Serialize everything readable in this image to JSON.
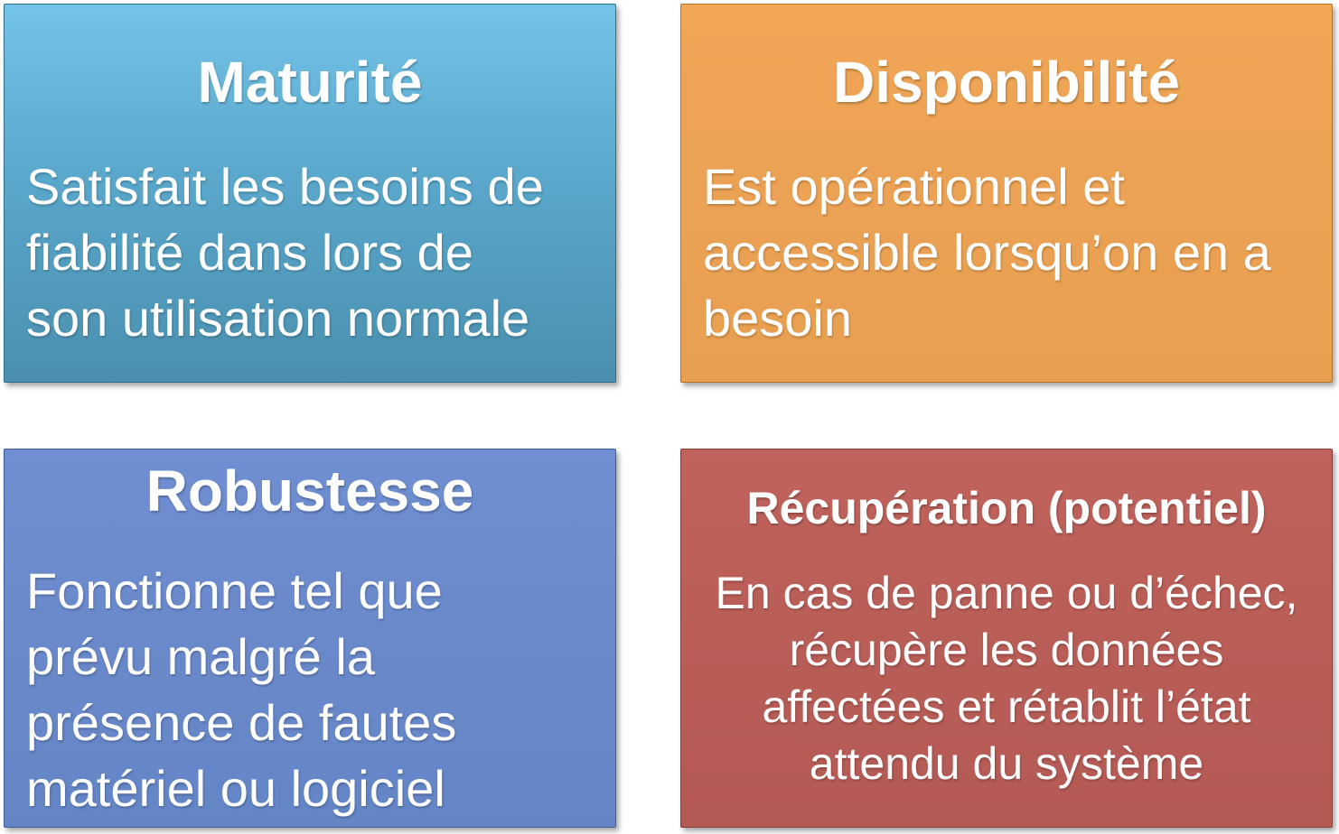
{
  "cards": [
    {
      "title": "Maturité",
      "lines": [
        "Satisfait les besoins de",
        "fiabilité dans lors de",
        "son utilisation normale"
      ],
      "color": "#5aa8cc"
    },
    {
      "title": "Disponibilité",
      "lines": [
        "Est opérationnel et",
        "accessible lorsqu’on en a",
        "besoin"
      ],
      "color": "#eca254"
    },
    {
      "title": "Robustesse",
      "lines": [
        "Fonctionne tel que",
        "prévu malgré la",
        "présence de fautes",
        "matériel ou logiciel"
      ],
      "color": "#6a89cb"
    },
    {
      "title": "Récupération (potentiel)",
      "lines": [
        "En cas de panne ou d’échec,",
        "récupère les données",
        "affectées et rétablit l’état",
        "attendu du système"
      ],
      "color": "#b95d57"
    }
  ]
}
